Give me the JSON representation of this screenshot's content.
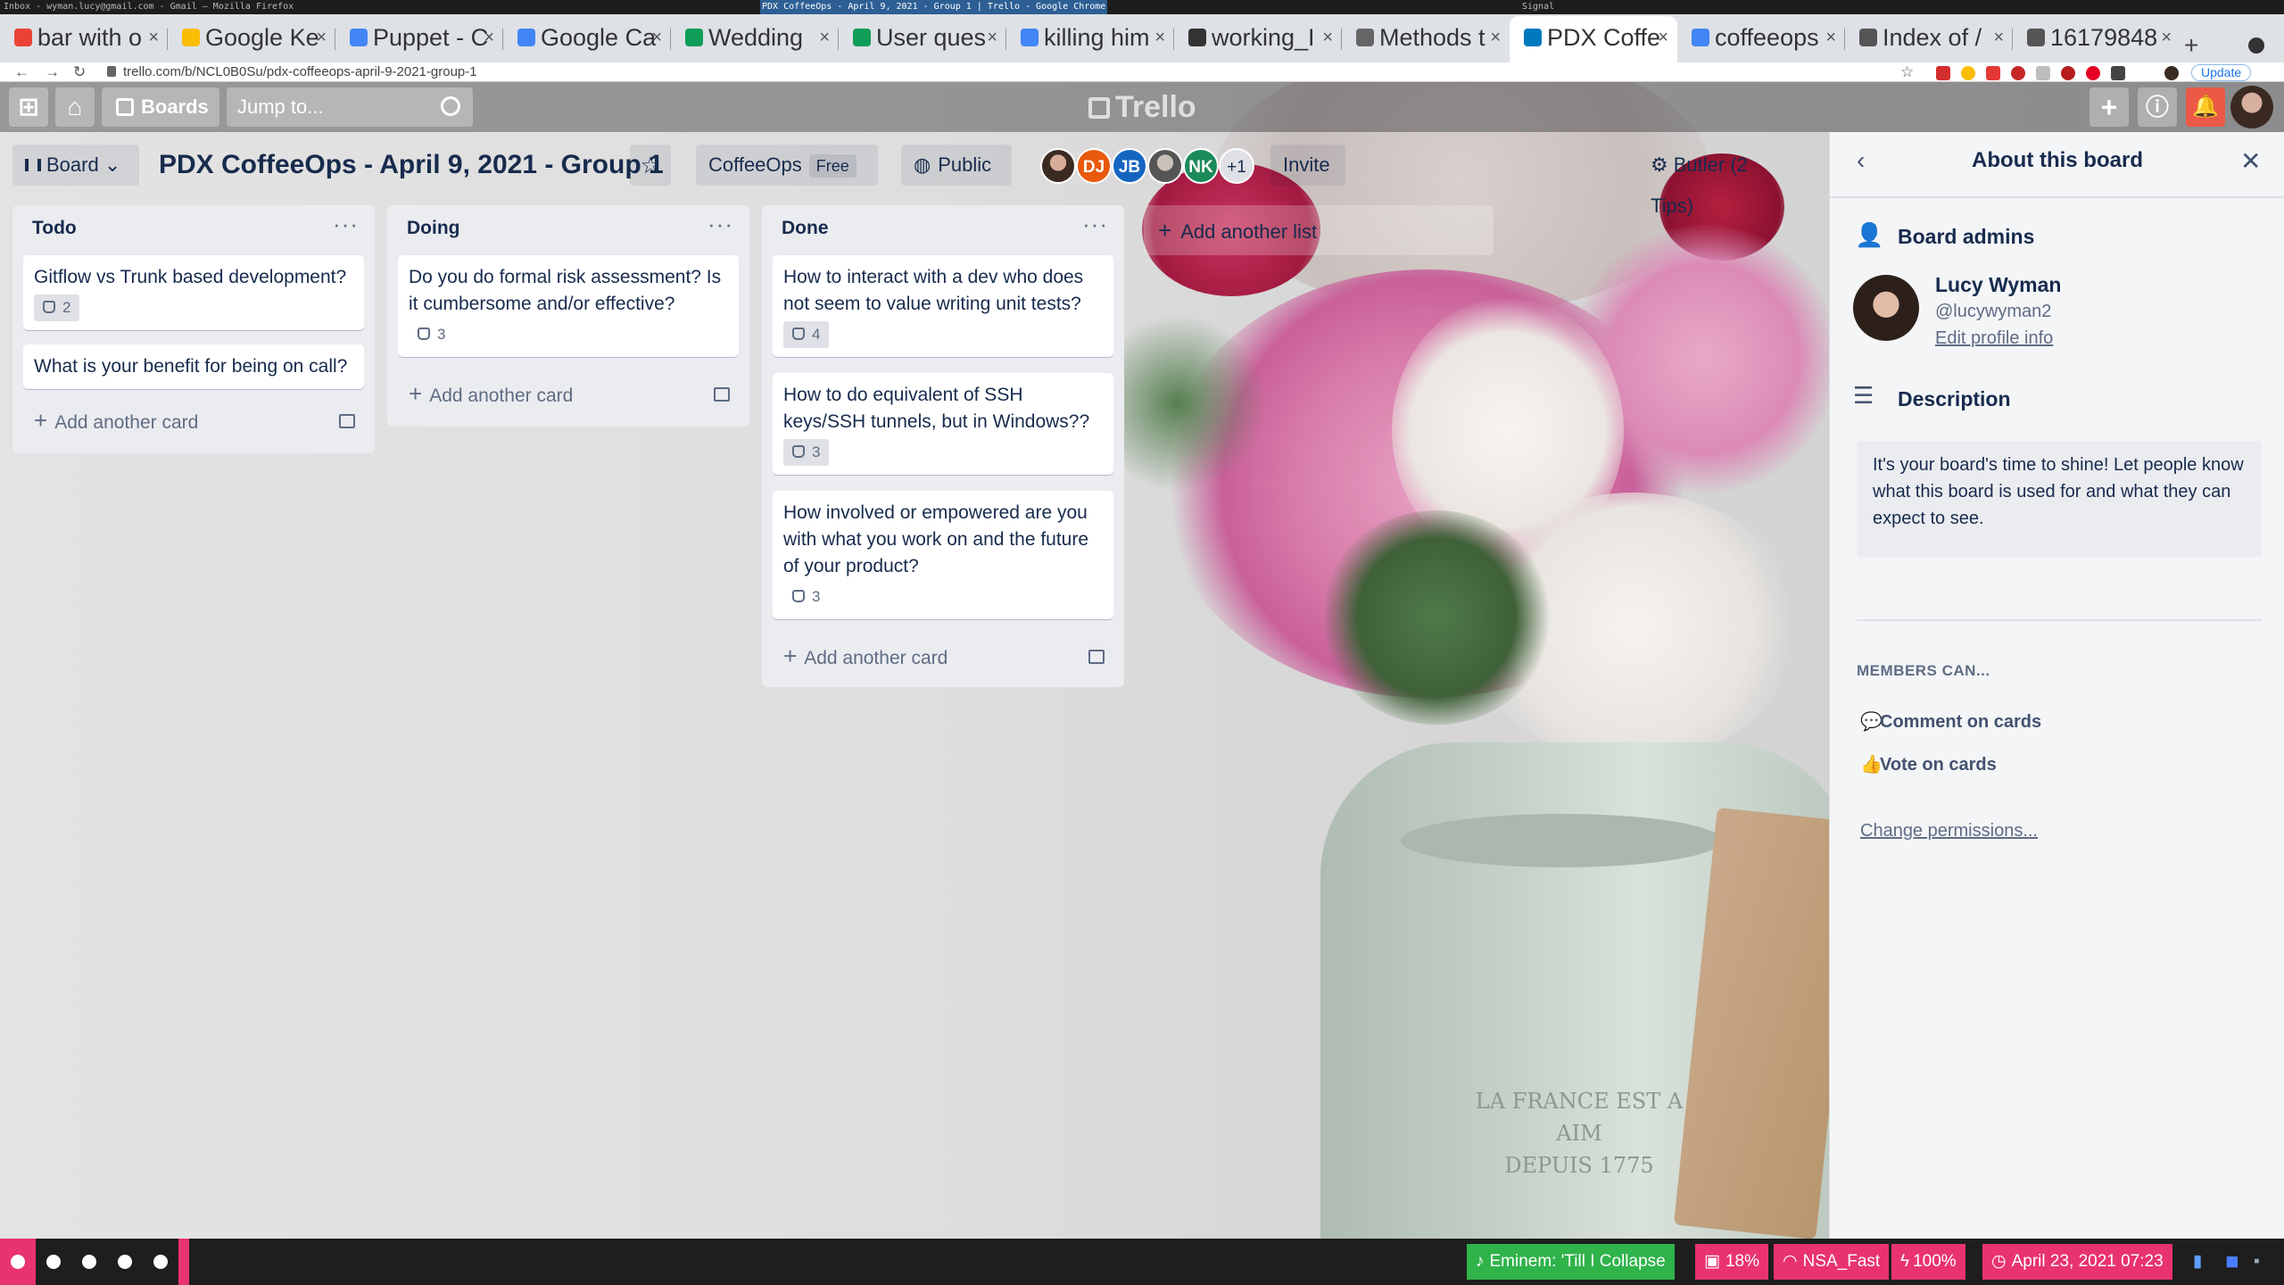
{
  "wm": {
    "left_title": "Inbox - wyman.lucy@gmail.com - Gmail — Mozilla Firefox",
    "center_title": "PDX CoffeeOps - April 9, 2021 - Group 1 | Trello - Google Chrome",
    "right_title": "Signal"
  },
  "tabs": [
    {
      "label": "bar with o",
      "color": "#ea4335"
    },
    {
      "label": "Google Ke",
      "color": "#fbbc04"
    },
    {
      "label": "Puppet - C",
      "color": "#4285f4"
    },
    {
      "label": "Google Ca",
      "color": "#4285f4"
    },
    {
      "label": "Wedding",
      "color": "#0f9d58"
    },
    {
      "label": "User ques",
      "color": "#0f9d58"
    },
    {
      "label": "killing him",
      "color": "#4285f4"
    },
    {
      "label": "working_I",
      "color": "#333333"
    },
    {
      "label": "Methods t",
      "color": "#666666"
    },
    {
      "label": "PDX Coffe",
      "color": "#0079bf"
    },
    {
      "label": "coffeeops",
      "color": "#4285f4"
    },
    {
      "label": "Index of /",
      "color": "#555555"
    },
    {
      "label": "16179848",
      "color": "#555555"
    }
  ],
  "browser": {
    "url": "trello.com/b/NCL0B0Su/pdx-coffeeops-april-9-2021-group-1",
    "update_label": "Update"
  },
  "header": {
    "boards_label": "Boards",
    "search_placeholder": "Jump to...",
    "logo_text": "Trello"
  },
  "board": {
    "view_label": "Board",
    "title": "PDX CoffeeOps - April 9, 2021 - Group 1",
    "workspace": "CoffeeOps",
    "plan_badge": "Free",
    "visibility": "Public",
    "members": [
      {
        "initials": "",
        "color": "#3a2a22"
      },
      {
        "initials": "DJ",
        "color": "#e8590c"
      },
      {
        "initials": "JB",
        "color": "#1565c0"
      },
      {
        "initials": "",
        "color": "#555555"
      },
      {
        "initials": "NK",
        "color": "#1b8a5a"
      }
    ],
    "extra_members": "+1",
    "invite_label": "Invite",
    "butler_label": "Butler (2 Tips)"
  },
  "lists": [
    {
      "title": "Todo",
      "cards": [
        {
          "text": "Gitflow vs Trunk based development?",
          "votes": "2"
        },
        {
          "text": "What is your benefit for being on call?",
          "votes": ""
        }
      ],
      "add_label": "Add another card"
    },
    {
      "title": "Doing",
      "cards": [
        {
          "text": "Do you do formal risk assessment? Is it cumbersome and/or effective?",
          "votes": "3"
        }
      ],
      "add_label": "Add another card"
    },
    {
      "title": "Done",
      "cards": [
        {
          "text": "How to interact with a dev who does not seem to value writing unit tests?",
          "votes": "4"
        },
        {
          "text": "How to do equivalent of SSH keys/SSH tunnels, but in Windows??",
          "votes": "3"
        },
        {
          "text": "How involved or empowered are you with what you work on and the future of your product?",
          "votes": "3"
        }
      ],
      "add_label": "Add another card"
    }
  ],
  "add_list_label": "Add another list",
  "panel": {
    "title": "About this board",
    "admins_heading": "Board admins",
    "admin_name": "Lucy Wyman",
    "admin_handle": "@lucywyman2",
    "edit_profile": "Edit profile info",
    "description_heading": "Description",
    "description_text": "It's your board's time to shine! Let people know what this board is used for and what they can expect to see.",
    "members_can_heading": "MEMBERS CAN...",
    "perm_comment": "Comment on cards",
    "perm_vote": "Vote on cards",
    "change_permissions": "Change permissions..."
  },
  "vase": {
    "engraving_line1": "LA FRANCE EST A AIM",
    "engraving_line2": "DEPUIS 1775"
  },
  "statusbar": {
    "music": "Eminem: 'Till I Collapse",
    "disk": "18%",
    "wifi": "NSA_Fast",
    "battery": "100%",
    "datetime": "April 23, 2021 07:23"
  }
}
